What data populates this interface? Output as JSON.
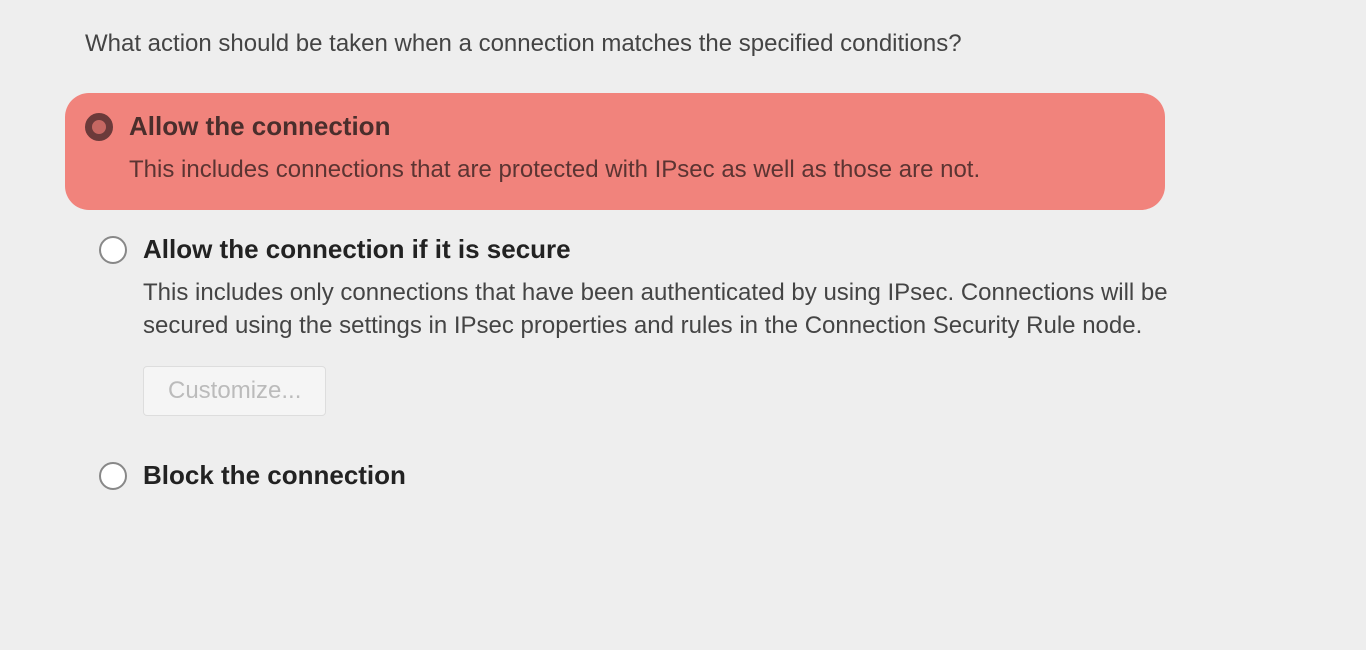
{
  "prompt": "What action should be taken when a connection matches the specified conditions?",
  "options": [
    {
      "label": "Allow the connection",
      "description": "This includes connections that are protected with IPsec as well as those are not."
    },
    {
      "label": "Allow the connection if it is secure",
      "description": "This includes only connections that have been authenticated by using IPsec.  Connections will be secured using the settings in IPsec properties and rules in the Connection Security Rule node."
    },
    {
      "label": "Block the connection"
    }
  ],
  "buttons": {
    "customize": "Customize..."
  }
}
